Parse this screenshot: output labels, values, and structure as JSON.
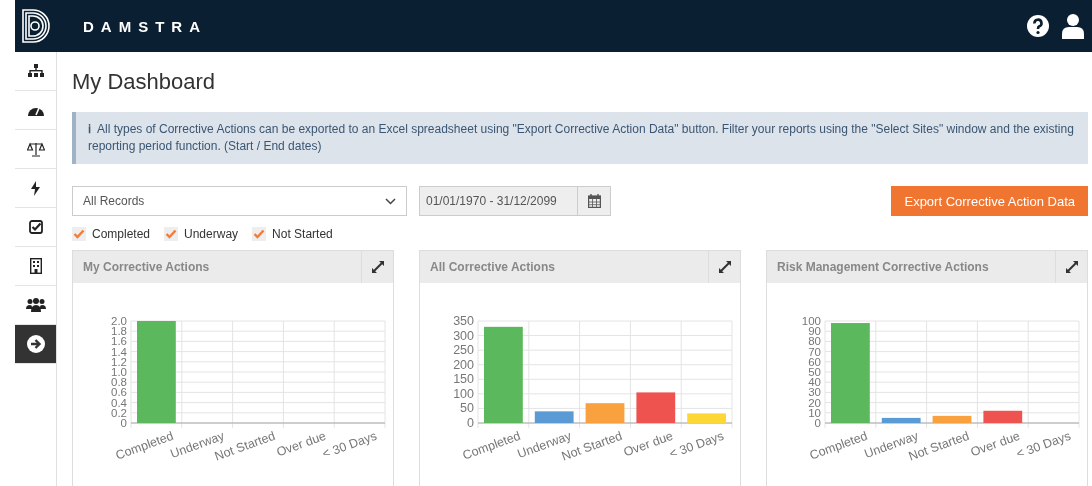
{
  "header": {
    "brand": "DAMSTRA"
  },
  "sidebar": {
    "items": [
      {
        "kind": "sitemap",
        "selected": false
      },
      {
        "kind": "gauge",
        "selected": false
      },
      {
        "kind": "scale",
        "selected": false
      },
      {
        "kind": "bolt",
        "selected": false
      },
      {
        "kind": "check",
        "selected": false
      },
      {
        "kind": "building",
        "selected": false
      },
      {
        "kind": "users",
        "selected": false
      },
      {
        "kind": "arrow",
        "selected": true
      }
    ]
  },
  "page": {
    "title": "My Dashboard"
  },
  "info": {
    "icon": "ℹ",
    "text": "All types of Corrective Actions can be exported to an Excel spreadsheet using \"Export Corrective Action Data\" button. Filter your reports using the \"Select Sites\" window and the existing reporting period function. (Start / End dates)"
  },
  "filters": {
    "records": "All Records",
    "date_range": "01/01/1970 - 31/12/2099",
    "export_button": "Export Corrective Action Data",
    "statuses": [
      {
        "label": "Completed",
        "checked": true
      },
      {
        "label": "Underway",
        "checked": true
      },
      {
        "label": "Not Started",
        "checked": true
      }
    ]
  },
  "cards": [
    {
      "title": "My Corrective Actions",
      "chart_data": {
        "type": "bar",
        "categories": [
          "Completed",
          "Underway",
          "Not Started",
          "Over due",
          "< 30 Days"
        ],
        "grid": true,
        "colors": [
          "#5cb85c",
          null,
          null,
          null,
          null
        ],
        "values": [
          2,
          0,
          0,
          0,
          0
        ],
        "ylim": [
          0,
          2
        ],
        "yticks": [
          0,
          {
            "value": 0.2,
            "label": "0.2"
          },
          {
            "value": 0.4,
            "label": "0.4"
          },
          {
            "value": 0.6,
            "label": "0.6"
          },
          {
            "value": 0.8,
            "label": "0.8"
          },
          {
            "value": 1,
            "label": "1.0"
          },
          {
            "value": 1.2,
            "label": "1.2"
          },
          {
            "value": 1.4,
            "label": "1.4"
          },
          {
            "value": 1.6,
            "label": "1.6"
          },
          {
            "value": 1.8,
            "label": "1.8"
          },
          {
            "value": 2,
            "label": "2.0"
          }
        ]
      }
    },
    {
      "title": "All Corrective Actions",
      "chart_data": {
        "type": "bar",
        "categories": [
          "Completed",
          "Underway",
          "Not Started",
          "Over due",
          "< 30 Days"
        ],
        "grid": true,
        "colors": [
          "#5cb85c",
          "#5b9bd5",
          "#f9a03f",
          "#ef5350",
          "#fdd835"
        ],
        "values": [
          330,
          40,
          68,
          105,
          33
        ],
        "ylim": [
          0,
          350
        ],
        "yticks": [
          0,
          50,
          100,
          150,
          200,
          250,
          300,
          350
        ]
      }
    },
    {
      "title": "Risk Management Corrective Actions",
      "chart_data": {
        "type": "bar",
        "categories": [
          "Completed",
          "Underway",
          "Not Started",
          "Over due",
          "< 30 Days"
        ],
        "grid": true,
        "colors": [
          "#5cb85c",
          "#5b9bd5",
          "#f9a03f",
          "#ef5350",
          null
        ],
        "values": [
          98,
          5,
          7,
          12,
          0
        ],
        "ylim": [
          0,
          100
        ],
        "yticks": [
          0,
          10,
          20,
          30,
          40,
          50,
          60,
          70,
          80,
          90,
          100
        ]
      }
    }
  ]
}
